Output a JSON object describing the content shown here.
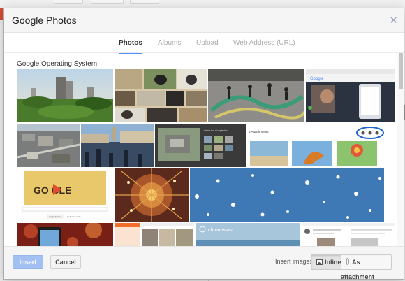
{
  "dialog": {
    "title": "Google Photos",
    "close_icon": "close-icon"
  },
  "tabs": [
    {
      "label": "Photos",
      "active": true
    },
    {
      "label": "Albums",
      "active": false
    },
    {
      "label": "Upload",
      "active": false
    },
    {
      "label": "Web Address (URL)",
      "active": false
    }
  ],
  "album": {
    "title": "Google Operating System"
  },
  "photos": [
    {
      "subject": "city skyline with trees"
    },
    {
      "subject": "dogs collage"
    },
    {
      "subject": "graffiti skateboarders"
    },
    {
      "subject": "google search page with phone"
    },
    {
      "subject": "aerial city view"
    },
    {
      "subject": "venice canal gondolas"
    },
    {
      "subject": "maps screenshot"
    },
    {
      "subject": "gmail attachments screenshot"
    },
    {
      "subject": "google doodle game"
    },
    {
      "subject": "festive dome lights"
    },
    {
      "subject": "snowy blue sky"
    },
    {
      "subject": "red bokeh phone"
    },
    {
      "subject": "orange app screenshot"
    },
    {
      "subject": "chromecast screenshot"
    },
    {
      "subject": "social post screenshot"
    }
  ],
  "inner_text": {
    "attach_heading": "5 Attachments",
    "doodle_letters": "GO GLE",
    "doodle_btn1": "Google Search",
    "doodle_btn2": "I'm Feeling Lucky",
    "chromecast": "chromecast"
  },
  "footer": {
    "insert_label": "Insert",
    "cancel_label": "Cancel",
    "insert_images_label": "Insert images",
    "inline_label": "Inline",
    "attachment_label": "As attachment"
  },
  "colors": {
    "accent": "#4d90fe",
    "insert_disabled": "#a3c0f2",
    "title_bar": "#f5f5f5"
  }
}
